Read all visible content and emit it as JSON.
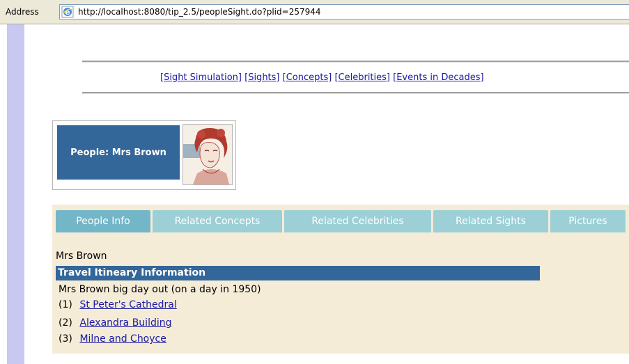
{
  "browser": {
    "address_label": "Address",
    "url": "http://localhost:8080/tip_2.5/peopleSight.do?plid=257944"
  },
  "nav": {
    "links": [
      "[Sight Simulation]",
      "[Sights]",
      "[Concepts]",
      "[Celebrities]",
      "[Events in Decades]"
    ]
  },
  "person": {
    "title": "People: Mrs Brown",
    "name": "Mrs Brown"
  },
  "tabs": [
    {
      "label": "People Info",
      "active": true
    },
    {
      "label": "Related Concepts",
      "active": false
    },
    {
      "label": "Related Celebrities",
      "active": false
    },
    {
      "label": "Related Sights",
      "active": false
    },
    {
      "label": "Pictures",
      "active": false
    }
  ],
  "itinerary": {
    "header": "Travel Itineary Information",
    "description": "Mrs Brown big day out (on a day in 1950)",
    "stops": [
      {
        "num": "(1)",
        "name": "St Peter's Cathedral"
      },
      {
        "num": "(2)",
        "name": "Alexandra Building"
      },
      {
        "num": "(3)",
        "name": "Milne and Choyce"
      }
    ]
  },
  "colors": {
    "header_blue": "#336699",
    "tab_active": "#73b6c8",
    "tab_inactive": "#9ccfd6",
    "panel_bg": "#f5ecd7",
    "link": "#1a1aa6"
  }
}
